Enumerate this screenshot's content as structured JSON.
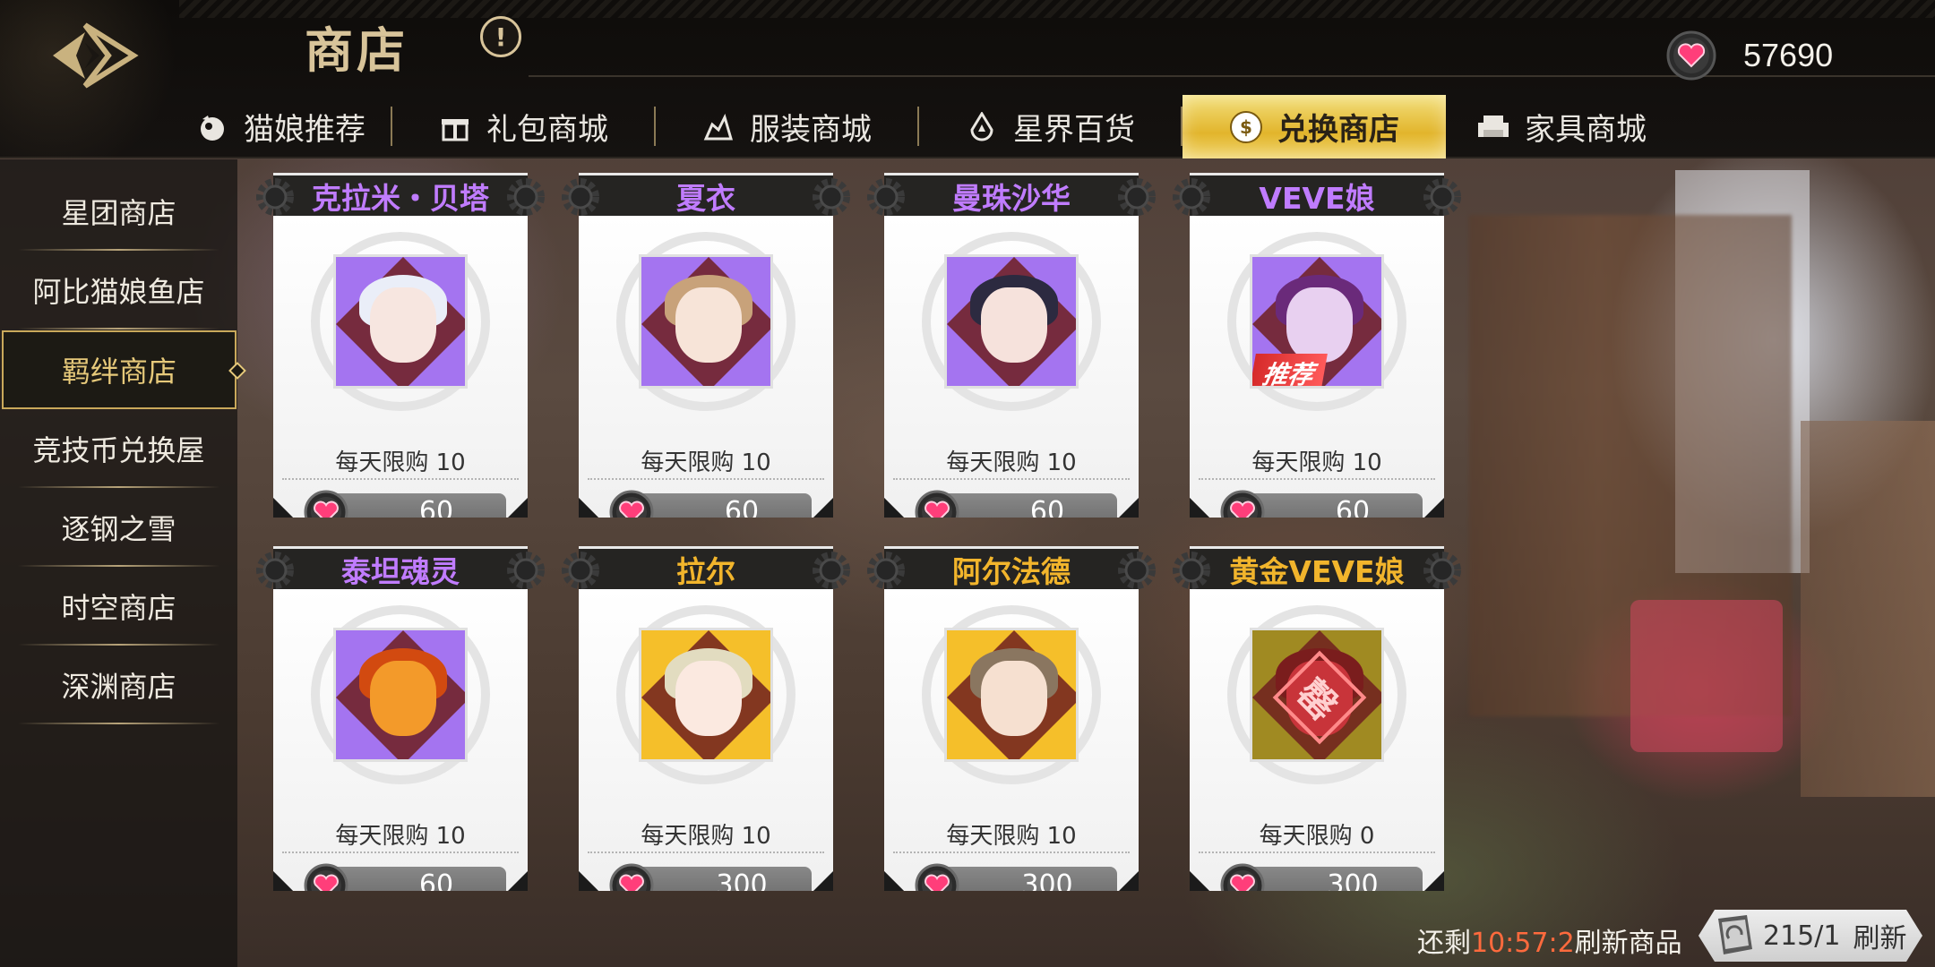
{
  "header": {
    "title": "商店",
    "info_symbol": "!",
    "currency_icon": "heart-coin-icon",
    "currency_value": "57690"
  },
  "tabs": [
    {
      "label": "猫娘推荐",
      "icon": "cat-bell-icon",
      "active": false
    },
    {
      "label": "礼包商城",
      "icon": "gift-icon",
      "active": false
    },
    {
      "label": "服装商城",
      "icon": "outfit-icon",
      "active": false
    },
    {
      "label": "星界百货",
      "icon": "star-drop-icon",
      "active": false
    },
    {
      "label": "兑换商店",
      "icon": "coin-exchange-icon",
      "active": true
    },
    {
      "label": "家具商城",
      "icon": "sofa-icon",
      "active": false
    }
  ],
  "sidebar": {
    "items": [
      {
        "label": "星团商店",
        "active": false
      },
      {
        "label": "阿比猫娘鱼店",
        "active": false
      },
      {
        "label": "羁绊商店",
        "active": true
      },
      {
        "label": "竞技币兑换屋",
        "active": false
      },
      {
        "label": "逐钢之雪",
        "active": false
      },
      {
        "label": "时空商店",
        "active": false
      },
      {
        "label": "深渊商店",
        "active": false
      }
    ]
  },
  "colors": {
    "name_purple": "#c07cff",
    "name_gold": "#f2b52c",
    "tile_purple": "#a474f0",
    "tile_gold": "#f5bf2a",
    "tile_olive": "#a08a22",
    "tab_active": "#e9c243",
    "timer": "#ff6a3d"
  },
  "items": [
    {
      "name": "克拉米・贝塔",
      "limit": "每天限购 10",
      "price": "60",
      "rarity": "purple",
      "recommend": false,
      "hair": "#eaeef8",
      "face": "#f7e6e0"
    },
    {
      "name": "夏衣",
      "limit": "每天限购 10",
      "price": "60",
      "rarity": "purple",
      "recommend": false,
      "hair": "#c8a27a",
      "face": "#f7e4d8"
    },
    {
      "name": "曼珠沙华",
      "limit": "每天限购 10",
      "price": "60",
      "rarity": "purple",
      "recommend": false,
      "hair": "#2c2a40",
      "face": "#f6e2dc"
    },
    {
      "name": "VEVE娘",
      "limit": "每天限购 10",
      "price": "60",
      "rarity": "purple",
      "recommend": true,
      "recommend_label": "推荐",
      "hair": "#6a2a7a",
      "face": "#e8d0f0"
    },
    {
      "name": "泰坦魂灵",
      "limit": "每天限购 10",
      "price": "60",
      "rarity": "purple",
      "recommend": false,
      "hair": "#d24a10",
      "face": "#f39a2a"
    },
    {
      "name": "拉尔",
      "limit": "每天限购 10",
      "price": "300",
      "rarity": "gold",
      "recommend": false,
      "hair": "#e2dcc0",
      "face": "#fbe9e0"
    },
    {
      "name": "阿尔法德",
      "limit": "每天限购 10",
      "price": "300",
      "rarity": "gold",
      "recommend": false,
      "hair": "#8a7660",
      "face": "#f6e0d0"
    },
    {
      "name": "黄金VEVE娘",
      "limit": "每天限购 0",
      "price": "300",
      "rarity": "olive",
      "recommend": false,
      "hair": "#7a1d1d",
      "face": "#c8343a",
      "sold_glyph": "罄"
    }
  ],
  "footer": {
    "refresh_prefix": "还剩",
    "refresh_timer": "10:57:2",
    "refresh_suffix": "刷新商品",
    "refresh_count": "215/1",
    "refresh_label": "刷新",
    "refresh_icon": "refresh-ticket-icon"
  }
}
